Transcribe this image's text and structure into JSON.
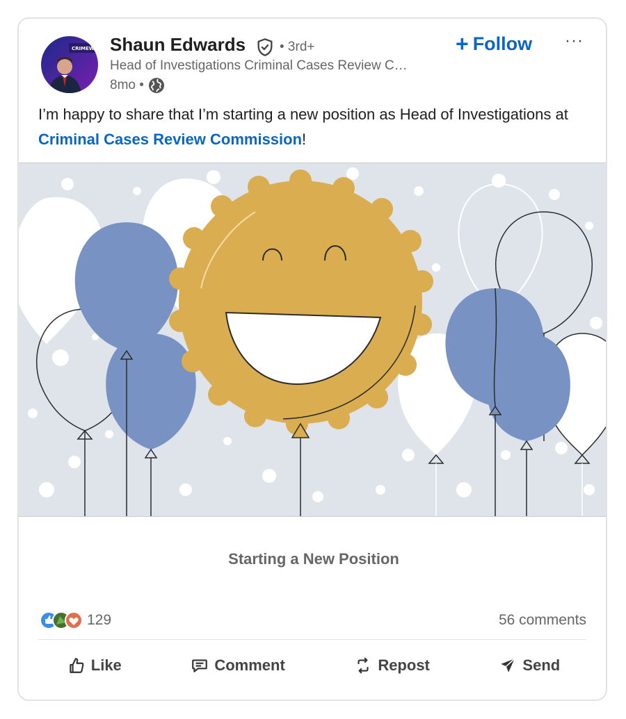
{
  "author": {
    "name": "Shaun Edwards",
    "degree": "• 3rd+",
    "headline": "Head of Investigations Criminal Cases Review C…",
    "time": "8mo •",
    "avatar_text": "CRIMEW"
  },
  "follow_label": "Follow",
  "more_label": "···",
  "post": {
    "text_before": "I’m happy to share that I’m starting a new position as Head of Investigations at ",
    "link_text": "Criminal Cases Review Commission",
    "text_after": "!"
  },
  "caption": "Starting a New Position",
  "reactions": {
    "count": "129",
    "comments": "56 comments"
  },
  "actions": {
    "like": "Like",
    "comment": "Comment",
    "repost": "Repost",
    "send": "Send"
  },
  "colors": {
    "accent": "#0a66c2",
    "balloon_blue": "#7792c3",
    "badge_gold": "#d9ad50",
    "hero_bg": "#dfe3ea"
  },
  "icons": [
    "verified-shield-icon",
    "globe-icon",
    "plus-icon",
    "more-icon",
    "like-icon",
    "comment-icon",
    "repost-icon",
    "send-icon"
  ]
}
